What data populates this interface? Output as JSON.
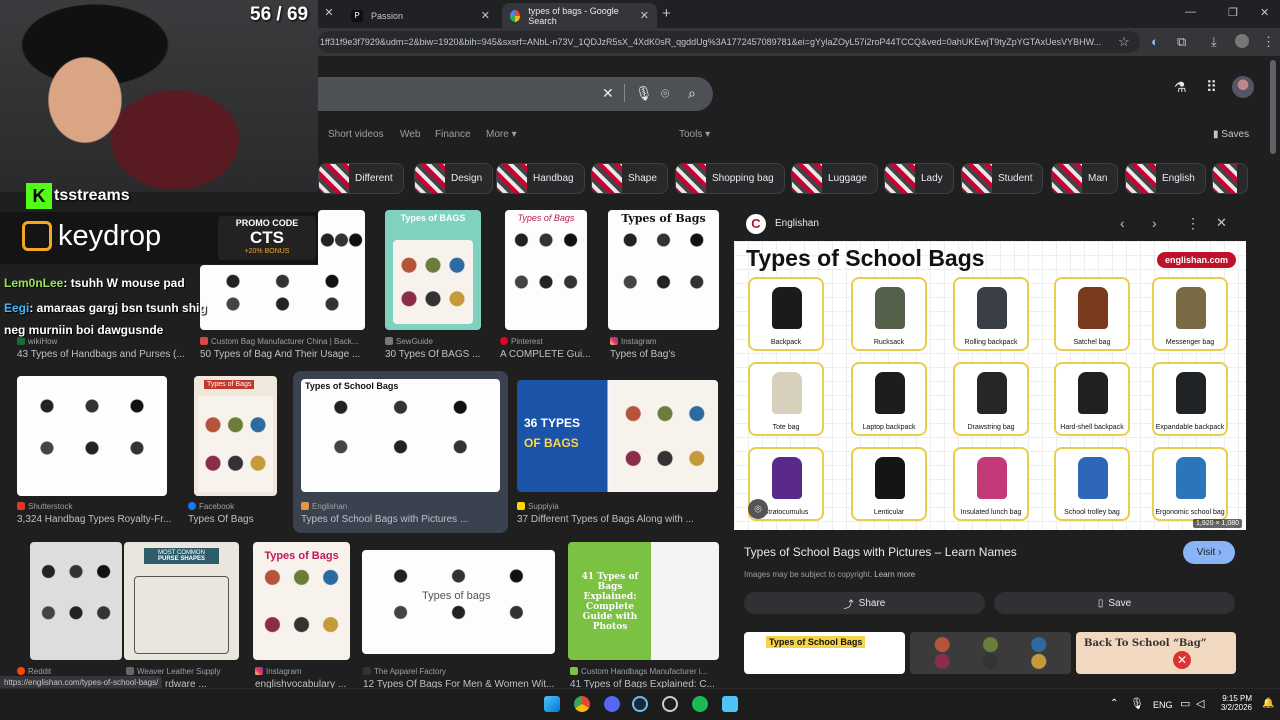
{
  "stream_overlay": {
    "counter": "56 / 69",
    "kts_label": "tsstreams",
    "brand": "keydrop",
    "promo_heading": "PROMO CODE",
    "promo_code": "CTS",
    "promo_bonus": "+20% BONUS",
    "chat": [
      {
        "user": "Lem0nLee",
        "msg": ": tsuhh W mouse pad",
        "color": "#9be15d"
      },
      {
        "user": "Eegi",
        "msg": ": аmaraas gargj bsn tsunh shig",
        "color": "#3fb8ff"
      },
      {
        "user": "",
        "msg": "neg murniin boi dawgusnde",
        "color": "#ffffff"
      }
    ]
  },
  "browser": {
    "tabs": [
      {
        "label": "Passion",
        "active": false
      },
      {
        "label": "types of bags - Google Search",
        "active": true
      }
    ],
    "new_tab": "+",
    "window_controls": [
      "—",
      "❐",
      "✕"
    ],
    "url": "1ff31f9e3f7929&udm=2&biw=1920&bih=945&sxsrf=ANbL-n73V_1QDJzR5sX_4XdK0sR_qgddUg%3A1772457089781&ei=gYylaZOyL57i2roP44TCCQ&ved=0ahUKEwjT9tyZpYGTAxUesVYBHW...",
    "status_url": "https://englishan.com/types-of-school-bags/"
  },
  "google": {
    "nav_tabs": [
      "Short videos",
      "Web",
      "Finance",
      "More",
      "Tools"
    ],
    "more_caret": "▾",
    "saves_label": "Saves",
    "chips": [
      "Different",
      "Design",
      "Handbag",
      "Shape",
      "Shopping bag",
      "Luggage",
      "Lady",
      "Student",
      "Man",
      "English"
    ],
    "results_row1": [
      {
        "source": "wikiHow",
        "title": "43 Types of Handbags and Purses (..."
      },
      {
        "source": "Custom Bag Manufacturer China | Back...",
        "title": "50 Types of Bag And Their Usage ..."
      },
      {
        "source": "SewGuide",
        "title": "30 Types Of BAGS ..."
      },
      {
        "source": "Pinterest",
        "title": "A COMPLETE Gui..."
      },
      {
        "source": "Instagram",
        "title": "Types of Bag's"
      }
    ],
    "results_row2": [
      {
        "source": "Shutterstock",
        "title": "3,324 Handbag Types Royalty-Fr..."
      },
      {
        "source": "Facebook",
        "title": "Types Of Bags"
      },
      {
        "source": "Englishan",
        "title": "Types of School Bags with Pictures ..."
      },
      {
        "source": "Supplyia",
        "title": "37 Different Types of Bags Along with ..."
      }
    ],
    "results_row3": [
      {
        "source": "Reddit",
        "title": ""
      },
      {
        "source": "Weaver Leather Supply",
        "title": "rdware ..."
      },
      {
        "source": "Instagram",
        "title": "englishvocabulary ..."
      },
      {
        "source": "The Apparel Factory",
        "title": "12 Types Of Bags For Men & Women Wit..."
      },
      {
        "source": "Custom Handbags Manufacturer i...",
        "title": "41 Types of Bags Explained: C..."
      }
    ],
    "thumb_texts": {
      "sewguide": "Types of BAGS",
      "pinterest": "Types of Bags",
      "instagram": "Types of Bags",
      "facebook": "Types of Bags",
      "englishan": "Types of School Bags",
      "supplyia_1": "36 TYPES",
      "supplyia_2": "OF BAGS",
      "weaver_1": "MOST COMMON",
      "weaver_2": "PURSE SHAPES",
      "insta2": "Types of Bags",
      "apparel": "Types of bags",
      "custom_41": "41 Types of Bags Explained: Complete Guide with Photos"
    }
  },
  "panel": {
    "source": "Englishan",
    "image_title": "Types of School Bags",
    "image_logo": "englishan.com",
    "bag_labels": [
      "Backpack",
      "Rucksack",
      "Rolling backpack",
      "Satchel bag",
      "Messenger bag",
      "Tote bag",
      "Laptop backpack",
      "Drawstring bag",
      "Hard-shell backpack",
      "Expandable backpack",
      "Stratocumulus",
      "Lenticular",
      "Insulated lunch bag",
      "School trolley bag",
      "Ergonomic school bag"
    ],
    "bag_colors": [
      "#1b1b1b",
      "#55604a",
      "#3a3f47",
      "#7a3a1d",
      "#7a6a44",
      "#d7d0bc",
      "#1d1d1d",
      "#262626",
      "#202020",
      "#1f2326",
      "#5a2a8a",
      "#151515",
      "#c43a78",
      "#2f67b8",
      "#2a76b9"
    ],
    "dimensions": "1,920 × 1,080",
    "title": "Types of School Bags with Pictures – Learn Names",
    "visit": "Visit",
    "copyright": "Images may be subject to copyright.",
    "learn_more": "Learn more",
    "share": "Share",
    "save": "Save",
    "related": [
      "Types of School Bags",
      "",
      "Back To School “Bag”"
    ]
  },
  "taskbar": {
    "lang": "ENG",
    "time": "9:15 PM",
    "date": "3/2/2026"
  }
}
